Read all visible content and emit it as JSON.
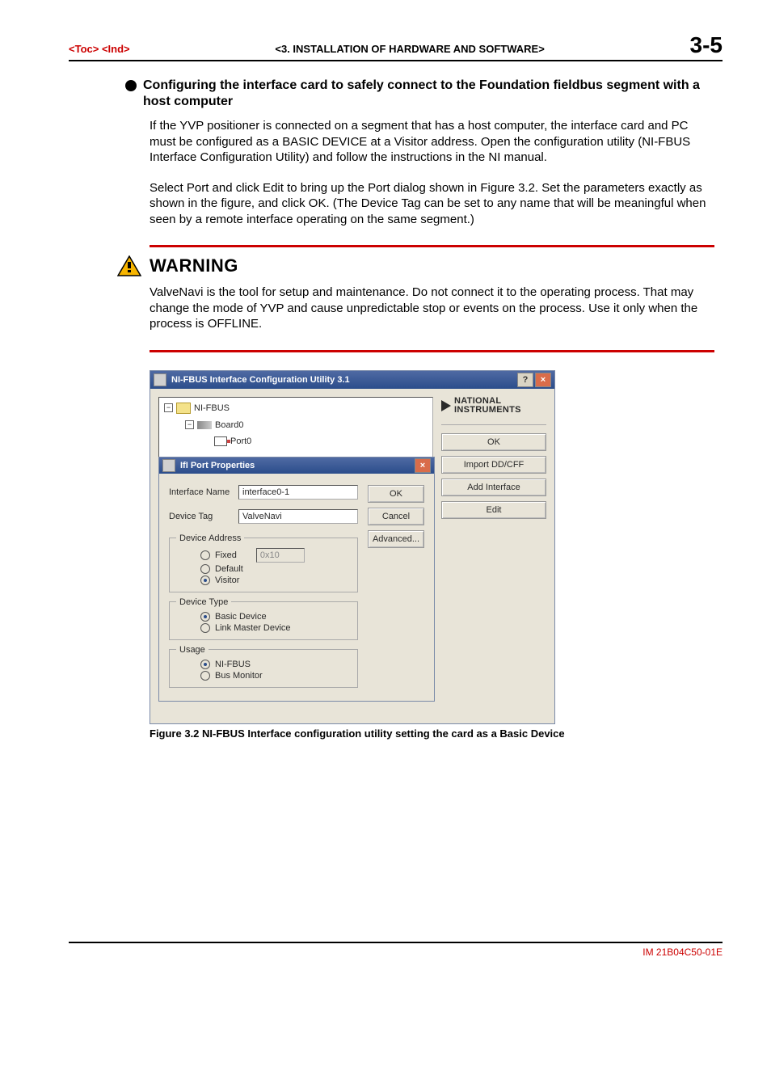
{
  "header": {
    "toc": "<Toc>",
    "ind": "<Ind>",
    "chapter": "<3.  INSTALLATION OF HARDWARE AND SOFTWARE>",
    "page_no": "3-5"
  },
  "section": {
    "bullet_title": "Configuring the interface card to safely connect to the Foundation fieldbus segment with a host computer",
    "para1": "If the YVP positioner is connected on a segment that has a host computer, the interface card and PC must be configured as a BASIC DEVICE at a Visitor address.  Open the configuration utility (NI-FBUS Interface Configuration Utility) and follow the instructions in the NI manual.",
    "para2": "Select Port and click Edit to bring up the Port dialog shown in Figure 3.2.  Set the parameters exactly as shown in the figure, and click OK. (The Device Tag can be set to any name that will be meaningful when seen by a remote interface operating on the same segment.)"
  },
  "warning": {
    "title": "WARNING",
    "text": "ValveNavi is the tool for setup and maintenance. Do not connect it to the operating  process. That may change the mode of YVP and cause unpredictable stop or events on the process. Use it only when the process is OFFLINE."
  },
  "app": {
    "title": "NI-FBUS Interface Configuration Utility 3.1",
    "help_glyph": "?",
    "close_glyph": "×",
    "tree": {
      "root": "NI-FBUS",
      "board": "Board0",
      "port": "Port0"
    },
    "logo": {
      "line1": "NATIONAL",
      "line2": "INSTRUMENTS"
    },
    "buttons": {
      "ok": "OK",
      "import": "Import DD/CFF",
      "add": "Add Interface",
      "edit": "Edit"
    }
  },
  "dialog": {
    "title": "IfI  Port Properties",
    "close_glyph": "×",
    "interface_name_label": "Interface Name",
    "interface_name_value": "interface0-1",
    "device_tag_label": "Device Tag",
    "device_tag_value": "ValveNavi",
    "buttons": {
      "ok": "OK",
      "cancel": "Cancel",
      "advanced": "Advanced..."
    },
    "device_address": {
      "legend": "Device Address",
      "fixed": "Fixed",
      "fixed_value": "0x10",
      "default": "Default",
      "visitor": "Visitor"
    },
    "device_type": {
      "legend": "Device Type",
      "basic": "Basic Device",
      "link_master": "Link Master Device"
    },
    "usage": {
      "legend": "Usage",
      "nifbus": "NI-FBUS",
      "bus_monitor": "Bus Monitor"
    }
  },
  "figure_caption": "Figure 3.2 NI-FBUS Interface configuration utility setting the card as a Basic Device",
  "footer": "IM 21B04C50-01E"
}
